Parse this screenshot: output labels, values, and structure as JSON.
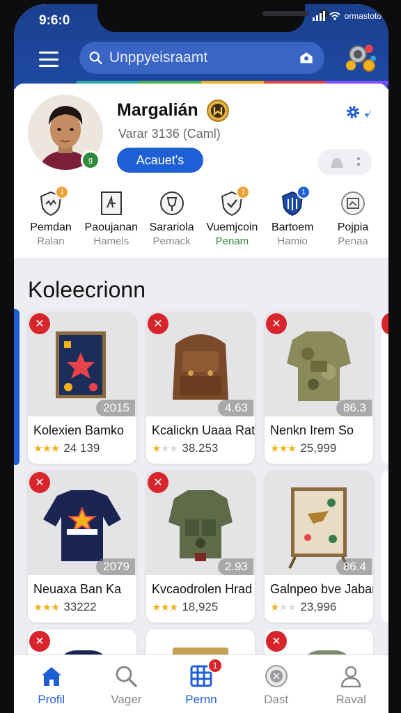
{
  "status_bar": {
    "time": "9:6:0",
    "brand": "ormastoto"
  },
  "search": {
    "placeholder": "Unppyeisraamt"
  },
  "profile": {
    "name": "Margalián",
    "subtitle": "Varar 3136 (Caml)",
    "action_label": "Acauet's"
  },
  "stats": [
    {
      "title": "Pemdan",
      "sub": "Ralan",
      "badge": "1",
      "badge_color": "#f0a030",
      "sub_color": "#888888"
    },
    {
      "title": "Paoujanan",
      "sub": "Hamels",
      "badge": "",
      "badge_color": "",
      "sub_color": "#888888"
    },
    {
      "title": "Sarariola",
      "sub": "Pemack",
      "badge": "",
      "badge_color": "",
      "sub_color": "#888888"
    },
    {
      "title": "Vuemjcoin",
      "sub": "Penam",
      "badge": "1",
      "badge_color": "#f0a030",
      "sub_color": "#2e8b3d"
    },
    {
      "title": "Bartoem",
      "sub": "Hamio",
      "badge": "1",
      "badge_color": "#1f5fd6",
      "sub_color": "#888888"
    },
    {
      "title": "Pojpia",
      "sub": "Penaa",
      "badge": "",
      "badge_color": "",
      "sub_color": "#888888"
    }
  ],
  "collection": {
    "title": "Koleecrionn",
    "items": [
      {
        "title": "Kolexien Bamko",
        "number": "2015",
        "count": "24 139",
        "badge": "✕",
        "stars": 3
      },
      {
        "title": "Kcalickn Uaaa Rat",
        "number": "4.63",
        "count": "38.253",
        "badge": "✕",
        "stars": 1
      },
      {
        "title": "Nenkn Irem So",
        "number": "86.3",
        "count": "25,999",
        "badge": "✕",
        "stars": 3
      },
      {
        "title": "Neuaxa Ban Ka",
        "number": "2079",
        "count": "33222",
        "badge": "✕",
        "stars": 3
      },
      {
        "title": "Kvcaodrolen Hrad",
        "number": "2.93",
        "count": "18,925",
        "badge": "✕",
        "stars": 3
      },
      {
        "title": "Galnpeo bve Jabar",
        "number": "86.4",
        "count": "23,996",
        "badge": "",
        "stars": 1
      }
    ]
  },
  "nav": [
    {
      "label": "Profil",
      "icon": "home-icon",
      "active": true
    },
    {
      "label": "Vager",
      "icon": "search-icon",
      "active": false
    },
    {
      "label": "Pernn",
      "icon": "grid-icon",
      "active": false,
      "badge": "1"
    },
    {
      "label": "Dast",
      "icon": "badge-icon",
      "active": false
    },
    {
      "label": "Raval",
      "icon": "person-icon",
      "active": false
    }
  ],
  "colors": {
    "header": "#1f4aa3",
    "accent": "#1f5fd6",
    "badge_red": "#d8242b",
    "star": "#f2b21b"
  }
}
